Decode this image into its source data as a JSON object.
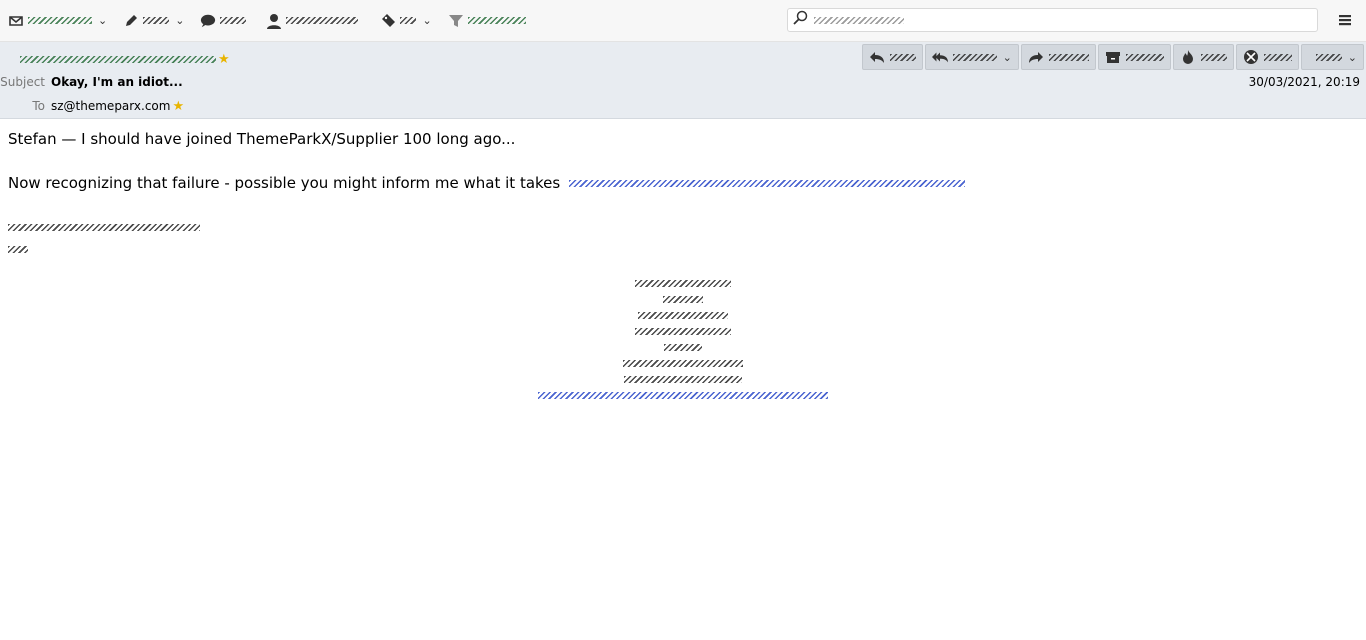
{
  "message": {
    "subject_label": "Subject",
    "subject": "Okay, I'm an idiot...",
    "to_label": "To",
    "to": "sz@themeparx.com",
    "date": "30/03/2021, 20:19"
  },
  "body": {
    "line1": "Stefan — I should have joined ThemeParkX/Supplier 100 long ago...",
    "line2": "Now recognizing that failure - possible you might inform me what it takes"
  },
  "icons": {
    "get_messages": "envelope-down-icon",
    "write": "pencil-icon",
    "chat": "chat-bubble-icon",
    "address_book": "contact-icon",
    "tag": "tag-icon",
    "filter": "funnel-icon",
    "search": "search-icon",
    "menu": "hamburger-icon",
    "star": "star-icon"
  },
  "colors": {
    "toolbar_bg": "#f7f7f7",
    "header_bg": "#e8ecf1",
    "star": "#e8b400"
  }
}
